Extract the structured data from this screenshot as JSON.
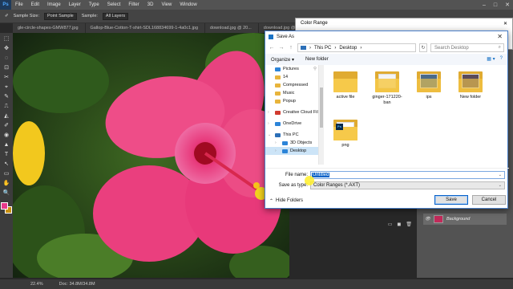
{
  "ps": {
    "logo": "Ps",
    "menus": [
      "File",
      "Edit",
      "Image",
      "Layer",
      "Type",
      "Select",
      "Filter",
      "3D",
      "View",
      "Window"
    ],
    "window_controls": [
      "–",
      "□",
      "✕"
    ],
    "options": {
      "sample_size_label": "Sample Size:",
      "sample_size_value": "Point Sample",
      "sample_label": "Sample:",
      "sample_value": "All Layers"
    },
    "tabs": [
      "gle-circle-shapes-GMW877.jpg",
      "Gallop-Blue-Cotton-T-shirt-SDL168834699-1-4a0c1.jpg",
      "download.jpg @ 20...",
      "download.jpg @ 2025.RGB/8"
    ],
    "tools": [
      "⬚",
      "✥",
      "◌",
      "⊡",
      "✂",
      "⌖",
      "✎",
      "⎍",
      "◭",
      "✐",
      "◉",
      "▲",
      "T",
      "↖",
      "▭",
      "✋",
      "🔍"
    ],
    "status": {
      "zoom": "22.4%",
      "doc": "Doc: 34.8M/34.8M"
    },
    "layer_name": "Background",
    "layer_footer_icons": [
      "▭",
      "◼",
      "🗑"
    ]
  },
  "color_range": {
    "title": "Color Range",
    "close": "✕"
  },
  "save_as": {
    "title": "Save As",
    "close": "✕",
    "nav_back": "←",
    "nav_forward": "→",
    "nav_up": "↑",
    "path": [
      "This PC",
      "›",
      "Desktop",
      "›"
    ],
    "search_placeholder": "Search Desktop",
    "organize": "Organize ▾",
    "new_folder": "New folder",
    "view_icons": [
      "▦ ▾",
      "?"
    ],
    "nav_items": [
      {
        "label": "Pictures"
      },
      {
        "label": "14"
      },
      {
        "label": "Compressed"
      },
      {
        "label": "Music"
      },
      {
        "label": "Popup"
      },
      {
        "label": "Creative Cloud Fil"
      },
      {
        "label": "OneDrive"
      },
      {
        "label": "This PC"
      },
      {
        "label": "3D Objects"
      },
      {
        "label": "Desktop"
      }
    ],
    "files": [
      "active file",
      "ginger-171220-ban",
      "ips",
      "New folder",
      "png"
    ],
    "file_name_label": "File name:",
    "file_name_value": "Untitled",
    "save_type_label": "Save as type:",
    "save_type_value": "Color Ranges (*.AXT)",
    "hide_folders": "Hide Folders",
    "save_button": "Save",
    "cancel_button": "Cancel"
  },
  "colors": {
    "ps_dark": "#282828",
    "accent": "#0a62c8",
    "flower": "#e83a7c",
    "foreground_swatch": "#e6388a",
    "background_swatch": "#c89010"
  }
}
